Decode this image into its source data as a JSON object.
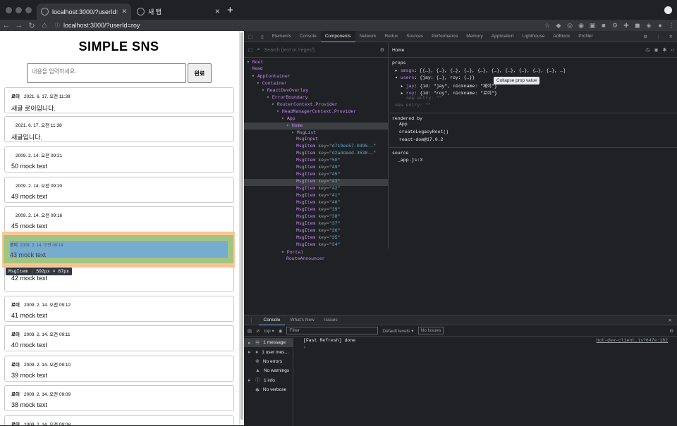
{
  "browser": {
    "tabs": [
      {
        "title": "localhost:3000/?userId=roy",
        "active": true
      },
      {
        "title": "새 탭",
        "active": false
      }
    ],
    "url": "localhost:3000/?userId=roy",
    "new_tab_label": "+"
  },
  "page": {
    "title": "SIMPLE SNS",
    "compose_placeholder": "내용을 입력하세요.",
    "submit_label": "완료",
    "messages": [
      {
        "user": "로이",
        "time": "2021. 6. 17. 오전 11:38",
        "text": "새글 로이입니다."
      },
      {
        "user": "",
        "time": "2021. 6. 17. 오전 11:38",
        "text": "새글입니다."
      },
      {
        "user": "",
        "time": "2009. 2. 14. 오전 09:21",
        "text": "50 mock text"
      },
      {
        "user": "",
        "time": "2009. 2. 14. 오전 09:20",
        "text": "49 mock text"
      },
      {
        "user": "",
        "time": "2009. 2. 14. 오전 09:16",
        "text": "45 mock text"
      },
      {
        "user": "로이",
        "time": "2009. 2. 14. 오전 09:14",
        "text": "43 mock text",
        "highlighted": true
      },
      {
        "user": "",
        "time": "",
        "text": "42 mock text"
      },
      {
        "user": "로이",
        "time": "2009. 2. 14. 오전 09:12",
        "text": "41 mock text"
      },
      {
        "user": "로이",
        "time": "2009. 2. 14. 오전 09:11",
        "text": "40 mock text"
      },
      {
        "user": "로이",
        "time": "2009. 2. 14. 오전 09:10",
        "text": "39 mock text"
      },
      {
        "user": "로이",
        "time": "2009. 2. 14. 오전 09:09",
        "text": "38 mock text"
      },
      {
        "user": "로이",
        "time": "2009. 2. 14. 오전 09:08",
        "text": ""
      }
    ],
    "inspect_tooltip": {
      "name": "MsgItem",
      "size": "592px × 87px"
    }
  },
  "devtools": {
    "tabs": [
      "Elements",
      "Console",
      "Components",
      "Network",
      "Redux",
      "Sources",
      "Performance",
      "Memory",
      "Application",
      "Lighthouse",
      "AdBlock",
      "Profiler"
    ],
    "active_tab": "Components",
    "search_placeholder": "Search (text or /regex/)",
    "tooltip": "Collapse prop value",
    "tree": [
      {
        "depth": 0,
        "name": "Root",
        "arrow": "▾"
      },
      {
        "depth": 1,
        "name": "Head",
        "arrow": ""
      },
      {
        "depth": 1,
        "name": "AppContainer",
        "arrow": "▾"
      },
      {
        "depth": 2,
        "name": "Container",
        "arrow": "▾"
      },
      {
        "depth": 3,
        "name": "ReactDevOverlay",
        "arrow": "▾"
      },
      {
        "depth": 4,
        "name": "ErrorBoundary",
        "arrow": "▾"
      },
      {
        "depth": 5,
        "name": "RouterContext.Provider",
        "arrow": "▾"
      },
      {
        "depth": 6,
        "name": "HeadManagerContext.Provider",
        "arrow": "▾"
      },
      {
        "depth": 7,
        "name": "App",
        "arrow": "▾"
      },
      {
        "depth": 8,
        "name": "Home",
        "arrow": "▾",
        "selected": true
      },
      {
        "depth": 9,
        "name": "MsgList",
        "arrow": "▾"
      },
      {
        "depth": 10,
        "name": "MsgInput",
        "arrow": ""
      },
      {
        "depth": 10,
        "name": "MsgItem",
        "key": "d719ee57-0395-…",
        "arrow": ""
      },
      {
        "depth": 10,
        "name": "MsgItem",
        "key": "d2addadd-3538-…",
        "arrow": ""
      },
      {
        "depth": 10,
        "name": "MsgItem",
        "key": "50",
        "arrow": ""
      },
      {
        "depth": 10,
        "name": "MsgItem",
        "key": "49",
        "arrow": ""
      },
      {
        "depth": 10,
        "name": "MsgItem",
        "key": "45",
        "arrow": ""
      },
      {
        "depth": 10,
        "name": "MsgItem",
        "key": "43",
        "arrow": "",
        "hovered": true
      },
      {
        "depth": 10,
        "name": "MsgItem",
        "key": "42",
        "arrow": ""
      },
      {
        "depth": 10,
        "name": "MsgItem",
        "key": "41",
        "arrow": ""
      },
      {
        "depth": 10,
        "name": "MsgItem",
        "key": "40",
        "arrow": ""
      },
      {
        "depth": 10,
        "name": "MsgItem",
        "key": "39",
        "arrow": ""
      },
      {
        "depth": 10,
        "name": "MsgItem",
        "key": "38",
        "arrow": ""
      },
      {
        "depth": 10,
        "name": "MsgItem",
        "key": "37",
        "arrow": ""
      },
      {
        "depth": 10,
        "name": "MsgItem",
        "key": "36",
        "arrow": ""
      },
      {
        "depth": 10,
        "name": "MsgItem",
        "key": "35",
        "arrow": ""
      },
      {
        "depth": 10,
        "name": "MsgItem",
        "key": "34",
        "arrow": ""
      },
      {
        "depth": 7,
        "name": "Portal",
        "arrow": "▾"
      },
      {
        "depth": 8,
        "name": "RouteAnnouncer",
        "arrow": ""
      }
    ],
    "selected_component": "Home",
    "props_header": "props",
    "props": [
      {
        "indent": 0,
        "arrow": "▸",
        "key": "smsgs",
        "value": "[{…}, {…}, {…}, {…}, {…}, {…}, {…}, {…}, {…}, {…}, …]"
      },
      {
        "indent": 0,
        "arrow": "▾",
        "key": "users",
        "value": "{jay: {…}, roy: {…}}"
      },
      {
        "indent": 1,
        "arrow": "▸",
        "key": "jay",
        "value": "{id: \"jay\", nickname: \"제이\"}"
      },
      {
        "indent": 1,
        "arrow": "▸",
        "key": "roy",
        "value": "{id: \"roy\", nickname: \"로이\"}"
      },
      {
        "indent": 2,
        "arrow": "",
        "key": "new entry",
        "value": "\"\"",
        "dim": true
      },
      {
        "indent": 0,
        "arrow": "",
        "key": "new entry",
        "value": "\"\"",
        "dim": true
      }
    ],
    "rendered_by_label": "rendered by",
    "rendered_by": [
      "App",
      "createLegacyRoot()",
      "react-dom@17.0.2"
    ],
    "source_label": "source",
    "source": "_app.js:3"
  },
  "console": {
    "tabs": [
      "Console",
      "What's New",
      "Issues"
    ],
    "context": "top",
    "filter_placeholder": "Filter",
    "levels": "Default levels ▾",
    "issues": "No Issues",
    "sidebar": [
      {
        "label": "1 message",
        "icon": "list-icon"
      },
      {
        "label": "1 user mes…",
        "icon": "user-icon"
      },
      {
        "label": "No errors",
        "icon": "error-icon"
      },
      {
        "label": "No warnings",
        "icon": "warning-icon"
      },
      {
        "label": "1 info",
        "icon": "info-icon"
      },
      {
        "label": "No verbose",
        "icon": "bug-icon"
      }
    ],
    "log": [
      {
        "text": "[Fast Refresh] done",
        "source": "hot-dev-client.js?647e:182"
      }
    ],
    "prompt": "›"
  }
}
